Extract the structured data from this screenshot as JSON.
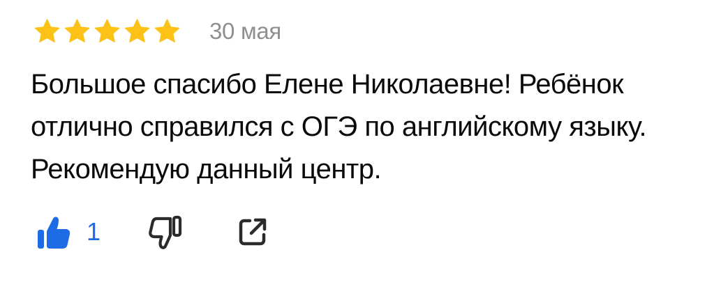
{
  "review": {
    "rating": 5,
    "rating_max": 5,
    "date": "30 мая",
    "text": "Большое спасибо Елене Николаевне! Ребёнок отлично справился с ОГЭ по английскому языку. Рекомендую данный центр.",
    "likes": "1",
    "icons": {
      "star": "star-icon",
      "like": "thumbs-up-icon",
      "dislike": "thumbs-down-icon",
      "share": "share-icon"
    }
  },
  "colors": {
    "star": "#fcc218",
    "accent": "#1e6be6",
    "date": "#8f8f8f",
    "icon": "#2b2b2b"
  }
}
